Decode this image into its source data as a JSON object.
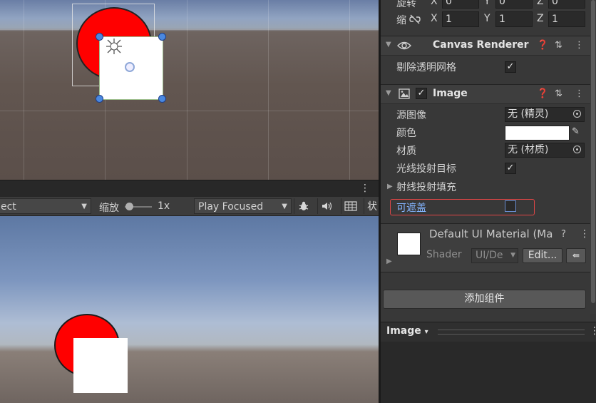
{
  "inspector": {
    "transform_scale": {
      "label_partial": "旋转",
      "scale_label": "缩",
      "x_label": "X",
      "y_label": "Y",
      "z_label": "Z",
      "top_x": "0",
      "top_y": "0",
      "top_z": "0",
      "x": "1",
      "y": "1",
      "z": "1"
    },
    "canvas_renderer": {
      "title": "Canvas Renderer",
      "cull_transparent_label": "剔除透明网格",
      "cull_transparent_checked": "✓"
    },
    "image": {
      "title": "Image",
      "enabled_check": "✓",
      "source_image_label": "源图像",
      "source_image_value": "无 (精灵)",
      "color_label": "颜色",
      "color_value": "#ffffff",
      "material_label": "材质",
      "material_value": "无 (材质)",
      "raycast_target_label": "光线投射目标",
      "raycast_target_checked": "✓",
      "raycast_padding_label": "射线投射填充",
      "maskable_label": "可遮盖",
      "maskable_checked": ""
    },
    "material_preview": {
      "name": "Default UI Material (Ma",
      "shader_label": "Shader",
      "shader_value": "UI/De",
      "edit_label": "Edit...",
      "help": "?",
      "kebab": "⋮"
    },
    "add_component_label": "添加组件",
    "preview": {
      "title": "Image",
      "dropdown_arrow": "▾"
    }
  },
  "game_toolbar": {
    "display_dropdown": "ect",
    "scale_label": "缩放",
    "scale_value": "1x",
    "play_mode_dropdown": "Play Focused",
    "stats_partial": "状"
  },
  "icons": {
    "eye": "eye-icon",
    "help": "help-icon",
    "preset": "preset-icon",
    "kebab": "kebab-icon",
    "bug": "bug-icon",
    "audio": "audio-icon",
    "grid": "grid-icon",
    "picker": "object-picker-icon",
    "eyedropper": "eyedropper-icon",
    "image_component": "image-component-icon"
  },
  "colors": {
    "red_circle": "#ff0000",
    "white_square": "#ffffff",
    "highlight_border": "#e04646",
    "maskable_label": "#84b4ff"
  }
}
